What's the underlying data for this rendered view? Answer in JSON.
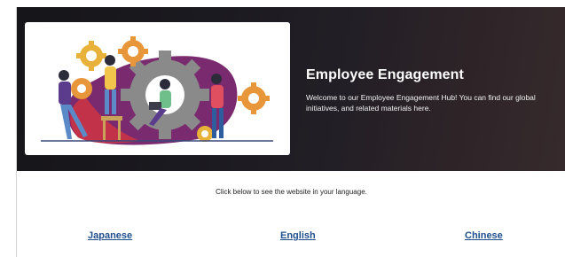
{
  "hero": {
    "title": "Employee Engagement",
    "description": "Welcome to our Employee Engagement Hub! You can find our global initiatives, and related materials here.",
    "illustration": "teamwork-gears-illustration"
  },
  "language_section": {
    "instruction": "Click below to see the website in your language.",
    "links": [
      {
        "label": "Japanese"
      },
      {
        "label": "English"
      },
      {
        "label": "Chinese"
      }
    ]
  },
  "colors": {
    "hero_background": "#1b1a20",
    "link": "#1f4e8c",
    "gear_orange": "#e8963a",
    "gear_gray": "#8a8a8a",
    "blob_purple": "#7a2a6e",
    "blob_red": "#c2334a"
  }
}
